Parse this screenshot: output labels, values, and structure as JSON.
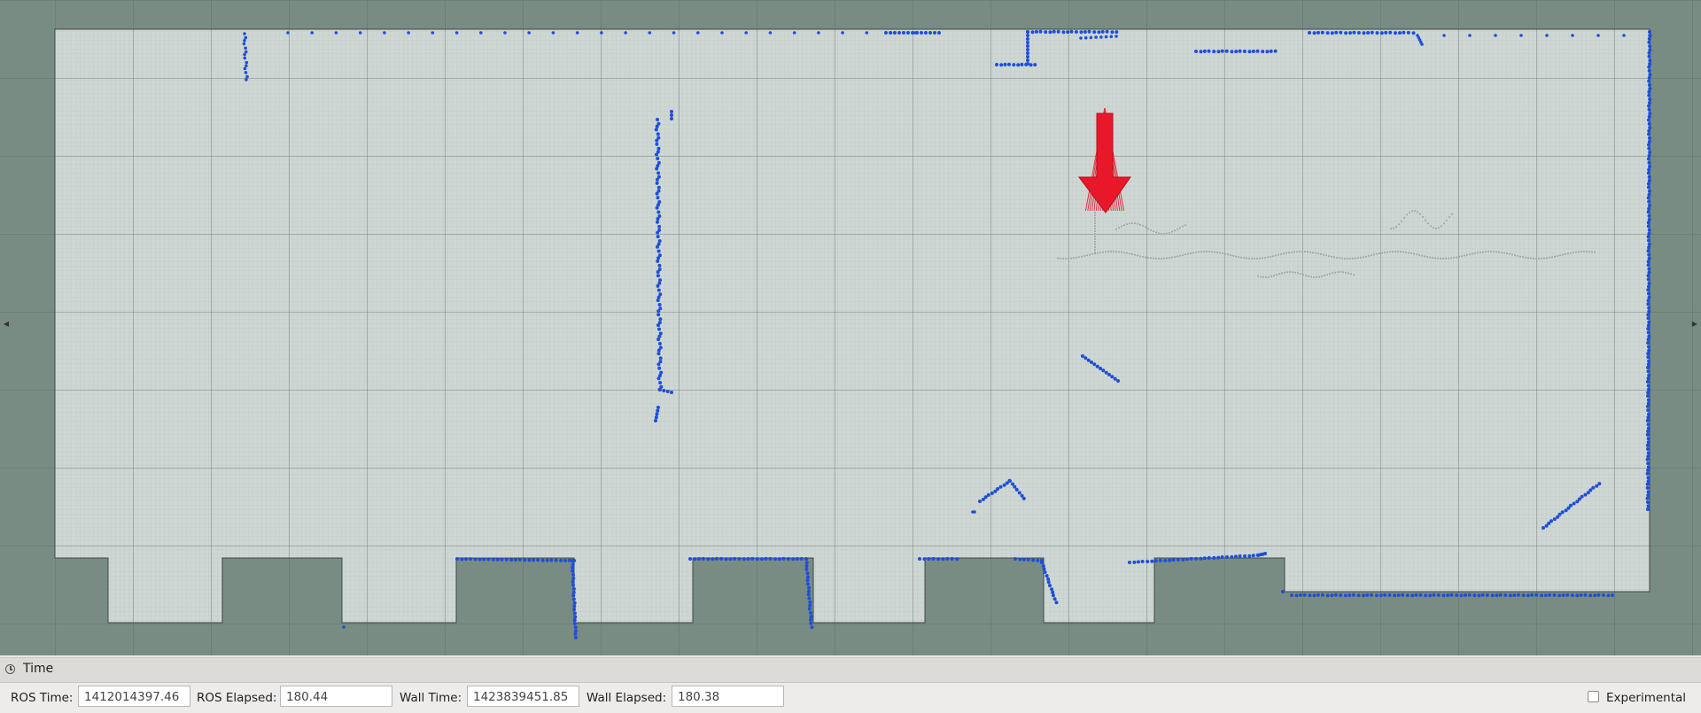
{
  "colors": {
    "background": "#798c84",
    "map_free": "#cfd7d4",
    "map_grid_fine": "#b3bfbb",
    "map_grid_major": "#55605d",
    "laser_points": "#1f4fd8",
    "pose_arrow": "#e8182a"
  },
  "icons": {
    "time_panel": "clock-icon",
    "left_edge": "triangle-left-icon",
    "right_edge": "triangle-right-icon"
  },
  "time_panel": {
    "title": "Time",
    "ros_time_label": "ROS Time:",
    "ros_time_value": "1412014397.46",
    "ros_elapsed_label": "ROS Elapsed:",
    "ros_elapsed_value": "180.44",
    "wall_time_label": "Wall Time:",
    "wall_time_value": "1423839451.85",
    "wall_elapsed_label": "Wall Elapsed:",
    "wall_elapsed_value": "180.38",
    "experimental_label": "Experimental",
    "experimental_checked": false
  }
}
